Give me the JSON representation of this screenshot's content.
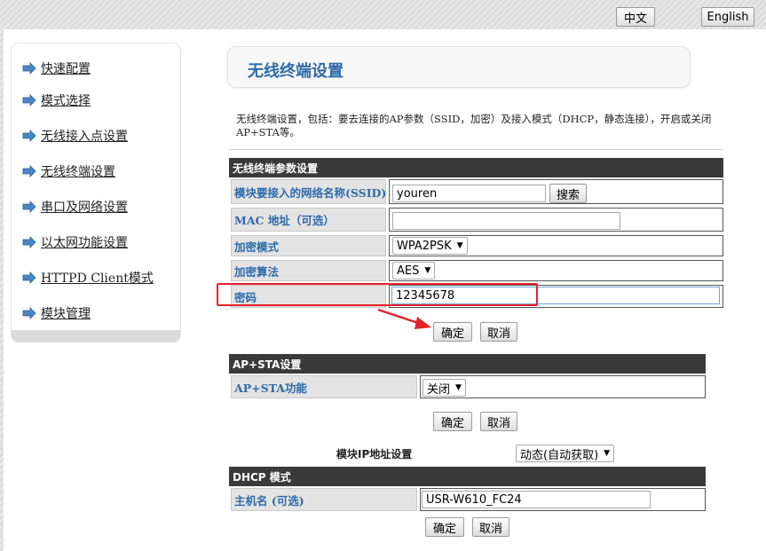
{
  "header": {
    "lang_cn": "中文",
    "lang_en": "English"
  },
  "sidebar": {
    "items": [
      {
        "label": "快速配置"
      },
      {
        "label": "模式选择"
      },
      {
        "label": "无线接入点设置"
      },
      {
        "label": "无线终端设置"
      },
      {
        "label": "串口及网络设置"
      },
      {
        "label": "以太网功能设置"
      },
      {
        "label": "HTTPD Client模式"
      },
      {
        "label": "模块管理"
      }
    ]
  },
  "main": {
    "title": "无线终端设置",
    "description": "无线终端设置，包括：要去连接的AP参数（SSID，加密）及接入模式（DHCP，静态连接），开启或关闭 AP+STA等。",
    "sta_section": {
      "header": "无线终端参数设置",
      "ssid_label": "模块要接入的网络名称(SSID)",
      "ssid_value": "youren",
      "search_button": "搜索",
      "mac_label": "MAC 地址（可选）",
      "mac_value": "",
      "enc_mode_label": "加密模式",
      "enc_mode_value": "WPA2PSK",
      "enc_alg_label": "加密算法",
      "enc_alg_value": "AES",
      "password_label": "密码",
      "password_value": "12345678",
      "ok_button": "确定",
      "cancel_button": "取消"
    },
    "apsta_section": {
      "header": "AP+STA设置",
      "func_label": "AP+STA功能",
      "func_value": "关闭",
      "ok_button": "确定",
      "cancel_button": "取消"
    },
    "ip_setting": {
      "label": "模块IP地址设置",
      "value": "动态(自动获取)"
    },
    "dhcp_section": {
      "header": "DHCP 模式",
      "hostname_label": "主机名 (可选)",
      "hostname_value": "USR-W610_FC24",
      "ok_button": "确定",
      "cancel_button": "取消"
    }
  },
  "colors": {
    "accent": "#2d6aa8",
    "header_bg": "#3a3a3a",
    "highlight": "#e8202a"
  }
}
